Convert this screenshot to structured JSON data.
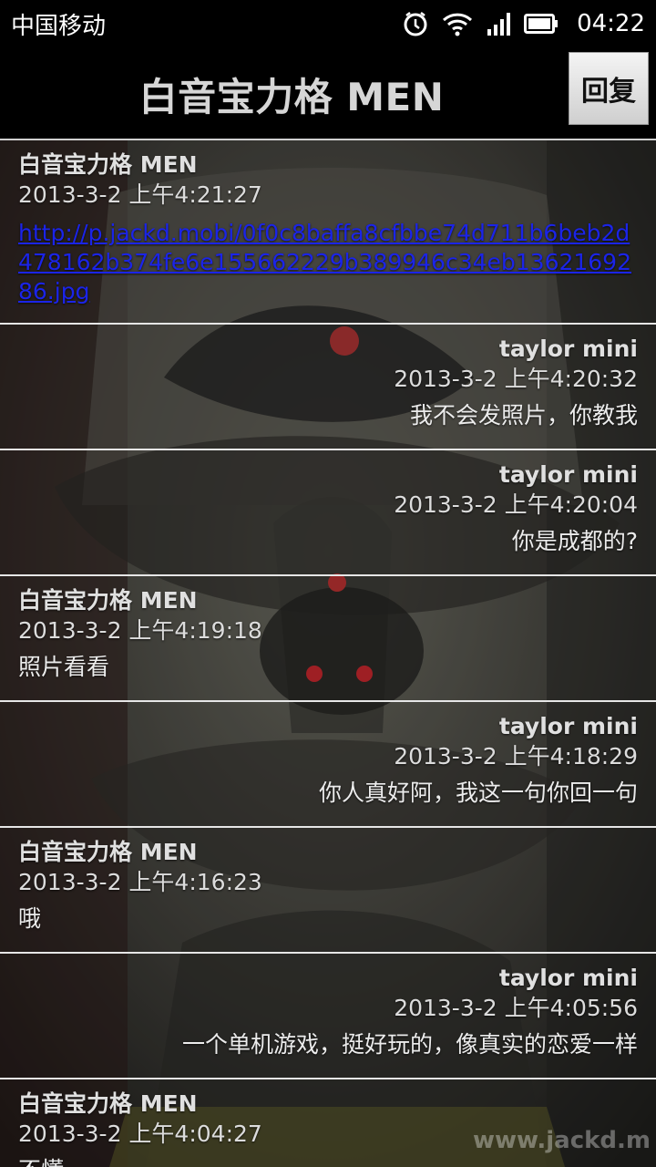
{
  "status_bar": {
    "carrier": "中国移动",
    "time": "04:22",
    "icons": [
      "alarm-icon",
      "wifi-icon",
      "signal-icon",
      "battery-icon"
    ]
  },
  "header": {
    "title": "白音宝力格 MEN",
    "reply_label": "回复"
  },
  "messages": [
    {
      "side": "left",
      "sender": "白音宝力格 MEN",
      "time": "2013-3-2 上午4:21:27",
      "link": "http://p.jackd.mobi/0f0c8baffa8cfbbe74d711b6beb2d478162b374fe6e155662229b389946c34eb1362169286.jpg"
    },
    {
      "side": "right",
      "sender": "taylor mini",
      "time": "2013-3-2 上午4:20:32",
      "text": "我不会发照片，你教我"
    },
    {
      "side": "right",
      "sender": "taylor mini",
      "time": "2013-3-2 上午4:20:04",
      "text": "你是成都的?"
    },
    {
      "side": "left",
      "sender": "白音宝力格 MEN",
      "time": "2013-3-2 上午4:19:18",
      "text": "照片看看"
    },
    {
      "side": "right",
      "sender": "taylor mini",
      "time": "2013-3-2 上午4:18:29",
      "text": "你人真好阿，我这一句你回一句"
    },
    {
      "side": "left",
      "sender": "白音宝力格 MEN",
      "time": "2013-3-2 上午4:16:23",
      "text": "哦"
    },
    {
      "side": "right",
      "sender": "taylor mini",
      "time": "2013-3-2 上午4:05:56",
      "text": "一个单机游戏，挺好玩的，像真实的恋爱一样"
    },
    {
      "side": "left",
      "sender": "白音宝力格 MEN",
      "time": "2013-3-2 上午4:04:27",
      "text": "不懂"
    }
  ],
  "watermark": "www.jackd.m"
}
